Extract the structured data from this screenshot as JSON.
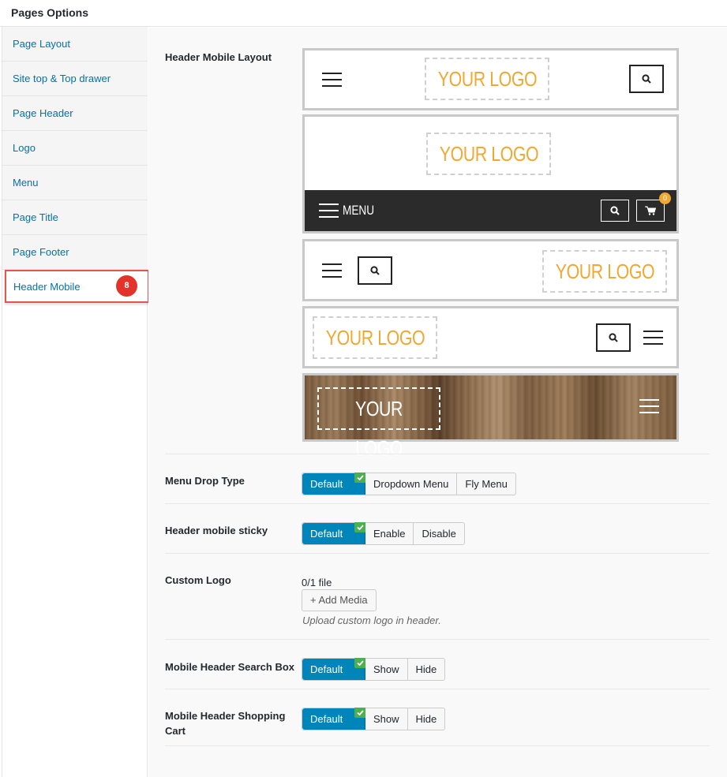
{
  "panel": {
    "title": "Pages Options"
  },
  "sidebar": {
    "items": [
      {
        "label": "Page Layout"
      },
      {
        "label": "Site top & Top drawer"
      },
      {
        "label": "Page Header"
      },
      {
        "label": "Logo"
      },
      {
        "label": "Menu"
      },
      {
        "label": "Page Title"
      },
      {
        "label": "Page Footer"
      },
      {
        "label": "Header Mobile",
        "badge": "8",
        "active": true
      }
    ]
  },
  "header_mobile_layout": {
    "label": "Header Mobile Layout",
    "layouts": [
      {
        "logo_text": "YOUR LOGO"
      },
      {
        "logo_text": "YOUR LOGO",
        "menu_text": "MENU",
        "cart_count": "0"
      },
      {
        "logo_text": "YOUR LOGO"
      },
      {
        "logo_text": "YOUR LOGO"
      },
      {
        "logo_text": "YOUR LOGO"
      }
    ]
  },
  "menu_drop_type": {
    "label": "Menu Drop Type",
    "options": [
      "Default",
      "Dropdown Menu",
      "Fly Menu"
    ],
    "selected": "Default"
  },
  "header_mobile_sticky": {
    "label": "Header mobile sticky",
    "options": [
      "Default",
      "Enable",
      "Disable"
    ],
    "selected": "Default"
  },
  "custom_logo": {
    "label": "Custom Logo",
    "file_count": "0/1 file",
    "add_media_label": "+ Add Media",
    "hint": "Upload custom logo in header."
  },
  "mobile_header_search_box": {
    "label": "Mobile Header Search Box",
    "options": [
      "Default",
      "Show",
      "Hide"
    ],
    "selected": "Default"
  },
  "mobile_header_shopping_cart": {
    "label": "Mobile Header Shopping Cart",
    "options": [
      "Default",
      "Show",
      "Hide"
    ],
    "selected": "Default"
  },
  "colors": {
    "accent": "#0085ba",
    "link": "#0073aa",
    "logo_orange": "#f0a830",
    "badge_red": "#e2342b",
    "check_green": "#4caf50"
  }
}
